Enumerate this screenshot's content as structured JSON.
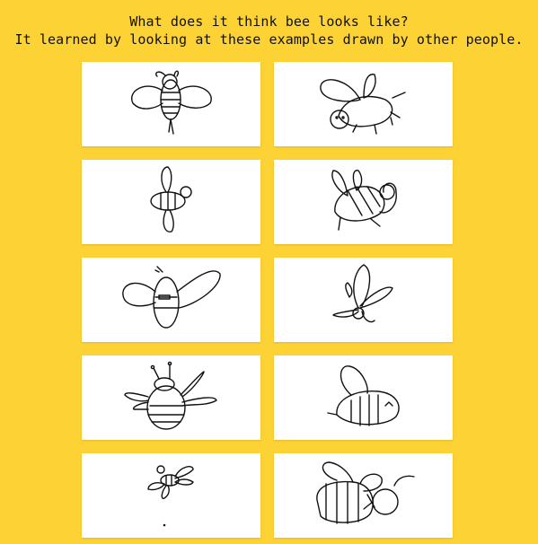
{
  "header": {
    "line1": "What does it think bee looks like?",
    "line2": "It learned by looking at these examples drawn by other people."
  },
  "examples": [
    {
      "label": "bee"
    },
    {
      "label": "bee"
    },
    {
      "label": "bee"
    },
    {
      "label": "bee"
    },
    {
      "label": "bee"
    },
    {
      "label": "bee"
    },
    {
      "label": "bee"
    },
    {
      "label": "bee"
    },
    {
      "label": "bee"
    },
    {
      "label": "bee"
    }
  ]
}
